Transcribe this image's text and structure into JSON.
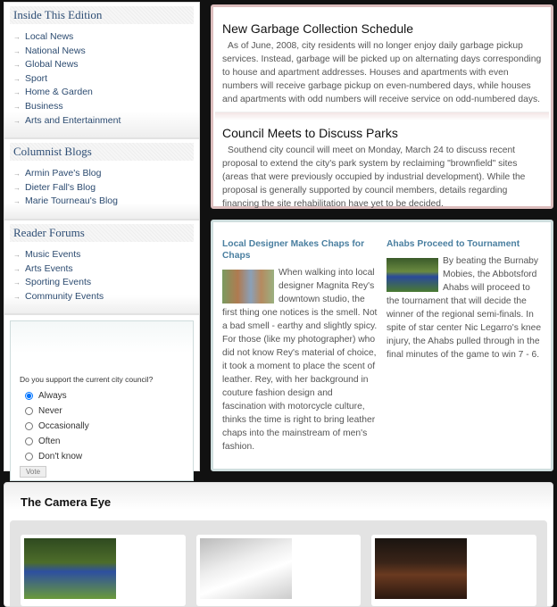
{
  "sidebar": {
    "sections": [
      {
        "title": "Inside This Edition",
        "items": [
          "Local News",
          "National News",
          "Global News",
          "Sport",
          "Home & Garden",
          "Business",
          "Arts and Entertainment"
        ]
      },
      {
        "title": "Columnist Blogs",
        "items": [
          "Armin Pave's Blog",
          "Dieter Fall's Blog",
          "Marie Tourneau's Blog"
        ]
      },
      {
        "title": "Reader Forums",
        "items": [
          "Music Events",
          "Arts Events",
          "Sporting Events",
          "Community Events"
        ]
      }
    ],
    "arrow": "→",
    "poll": {
      "question": "Do you support the current city council?",
      "options": [
        "Always",
        "Never",
        "Occasionally",
        "Often",
        "Don't know"
      ],
      "selected": "Always",
      "vote_label": "Vote"
    }
  },
  "top_articles": [
    {
      "title": "New Garbage Collection Schedule",
      "body": "As of June, 2008, city residents will no longer enjoy daily garbage pickup services. Instead, garbage will be picked up on alternating days corresponding to house and apartment addresses. Houses and apartments with even numbers will receive garbage pickup on even-numbered days, while houses and apartments with odd numbers will receive service on odd-numbered days."
    },
    {
      "title": "Council Meets to Discuss Parks",
      "body": "Southend city council will meet on Monday, March 24 to discuss recent proposal to extend the city's park system by reclaiming \"brownfield\" sites (areas that were previously occupied by industrial development). While the proposal is generally supported by council members, details regarding financing the site rehabilitation have yet to be decided."
    }
  ],
  "features": [
    {
      "title": "Local Designer Makes Chaps for Chaps",
      "body": "When walking into local designer Magnita Rey's downtown studio, the first thing one notices is the smell. Not a bad smell - earthy and slightly spicy. For those (like my photographer) who did not know Rey's material of choice, it took a moment to place the scent of leather. Rey, with her background in couture fashion design and fascination with motorcycle culture, thinks the time is right to bring leather chaps into the mainstream of men's fashion."
    },
    {
      "title": "Ahabs Proceed to Tournament",
      "body": "By beating the Burnaby Mobies, the Abbotsford Ahabs will proceed to the tournament that will decide the winner of the regional semi-finals. In spite of star center Nic Legarro's knee injury, the Ahabs pulled through in the final minutes of the game to win 7 - 6."
    }
  ],
  "gallery": {
    "title": "The Camera Eye"
  }
}
